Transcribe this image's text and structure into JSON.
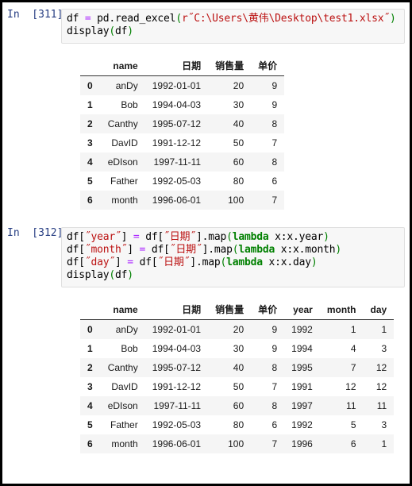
{
  "notebook": {
    "cells": [
      {
        "prompt": "In  [311]:",
        "code_lines": [
          [
            {
              "t": "df ",
              "c": "plain"
            },
            {
              "t": "=",
              "c": "op"
            },
            {
              "t": " pd.read_excel",
              "c": "plain"
            },
            {
              "t": "(",
              "c": "paren"
            },
            {
              "t": "r˝C:\\Users\\黄伟\\Desktop\\test1.xlsx˝",
              "c": "str"
            },
            {
              "t": ")",
              "c": "paren"
            }
          ],
          [
            {
              "t": "display",
              "c": "plain"
            },
            {
              "t": "(",
              "c": "paren"
            },
            {
              "t": "df",
              "c": "plain"
            },
            {
              "t": ")",
              "c": "paren"
            }
          ]
        ]
      },
      {
        "prompt": "In  [312]:",
        "code_lines": [
          [
            {
              "t": "df[",
              "c": "plain"
            },
            {
              "t": "˝year˝",
              "c": "str"
            },
            {
              "t": "] ",
              "c": "plain"
            },
            {
              "t": "=",
              "c": "op"
            },
            {
              "t": " df[",
              "c": "plain"
            },
            {
              "t": "˝日期˝",
              "c": "str"
            },
            {
              "t": "].map",
              "c": "plain"
            },
            {
              "t": "(",
              "c": "paren"
            },
            {
              "t": "lambda",
              "c": "kw"
            },
            {
              "t": " x:x.year",
              "c": "plain"
            },
            {
              "t": ")",
              "c": "paren"
            }
          ],
          [
            {
              "t": "df[",
              "c": "plain"
            },
            {
              "t": "˝month˝",
              "c": "str"
            },
            {
              "t": "] ",
              "c": "plain"
            },
            {
              "t": "=",
              "c": "op"
            },
            {
              "t": " df[",
              "c": "plain"
            },
            {
              "t": "˝日期˝",
              "c": "str"
            },
            {
              "t": "].map",
              "c": "plain"
            },
            {
              "t": "(",
              "c": "paren"
            },
            {
              "t": "lambda",
              "c": "kw"
            },
            {
              "t": " x:x.month",
              "c": "plain"
            },
            {
              "t": ")",
              "c": "paren"
            }
          ],
          [
            {
              "t": "df[",
              "c": "plain"
            },
            {
              "t": "˝day˝",
              "c": "str"
            },
            {
              "t": "] ",
              "c": "plain"
            },
            {
              "t": "=",
              "c": "op"
            },
            {
              "t": " df[",
              "c": "plain"
            },
            {
              "t": "˝日期˝",
              "c": "str"
            },
            {
              "t": "].map",
              "c": "plain"
            },
            {
              "t": "(",
              "c": "paren"
            },
            {
              "t": "lambda",
              "c": "kw"
            },
            {
              "t": " x:x.day",
              "c": "plain"
            },
            {
              "t": ")",
              "c": "paren"
            }
          ],
          [
            {
              "t": "display",
              "c": "plain"
            },
            {
              "t": "(",
              "c": "paren"
            },
            {
              "t": "df",
              "c": "plain"
            },
            {
              "t": ")",
              "c": "paren"
            }
          ]
        ]
      }
    ]
  },
  "tables": [
    {
      "index_header": "",
      "columns": [
        "name",
        "日期",
        "销售量",
        "单价"
      ],
      "index": [
        "0",
        "1",
        "2",
        "3",
        "4",
        "5",
        "6"
      ],
      "rows": [
        [
          "anDy",
          "1992-01-01",
          "20",
          "9"
        ],
        [
          "Bob",
          "1994-04-03",
          "30",
          "9"
        ],
        [
          "Canthy",
          "1995-07-12",
          "40",
          "8"
        ],
        [
          "DavID",
          "1991-12-12",
          "50",
          "7"
        ],
        [
          "eDIson",
          "1997-11-11",
          "60",
          "8"
        ],
        [
          "Father",
          "1992-05-03",
          "80",
          "6"
        ],
        [
          "month",
          "1996-06-01",
          "100",
          "7"
        ]
      ]
    },
    {
      "index_header": "",
      "columns": [
        "name",
        "日期",
        "销售量",
        "单价",
        "year",
        "month",
        "day"
      ],
      "index": [
        "0",
        "1",
        "2",
        "3",
        "4",
        "5",
        "6"
      ],
      "rows": [
        [
          "anDy",
          "1992-01-01",
          "20",
          "9",
          "1992",
          "1",
          "1"
        ],
        [
          "Bob",
          "1994-04-03",
          "30",
          "9",
          "1994",
          "4",
          "3"
        ],
        [
          "Canthy",
          "1995-07-12",
          "40",
          "8",
          "1995",
          "7",
          "12"
        ],
        [
          "DavID",
          "1991-12-12",
          "50",
          "7",
          "1991",
          "12",
          "12"
        ],
        [
          "eDIson",
          "1997-11-11",
          "60",
          "8",
          "1997",
          "11",
          "11"
        ],
        [
          "Father",
          "1992-05-03",
          "80",
          "6",
          "1992",
          "5",
          "3"
        ],
        [
          "month",
          "1996-06-01",
          "100",
          "7",
          "1996",
          "6",
          "1"
        ]
      ]
    }
  ],
  "colors": {
    "prompt": "#263d82",
    "string": "#bb1111",
    "keyword": "#008000",
    "operator": "#aa22ff",
    "cell_bg": "#f7f7f7",
    "cell_border": "#dfdfdf",
    "row_stripe": "#f5f5f5",
    "page_border": "#000000"
  }
}
